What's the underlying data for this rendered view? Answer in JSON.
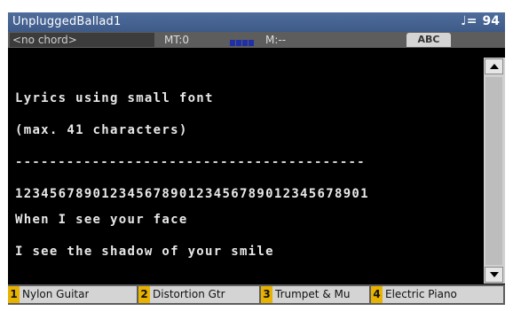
{
  "title_bar": {
    "song_name": "UnpluggedBallad1",
    "tempo_icon": "♩=",
    "tempo": "94"
  },
  "info_bar": {
    "chord": "<no chord>",
    "master_transpose": "MT:0",
    "measure": "M:--",
    "abc_label": "ABC"
  },
  "lyrics": {
    "lines": [
      "Lyrics using small font",
      "(max. 41 characters)",
      "-----------------------------------------",
      "12345678901234567890123456789012345678901",
      "When I see your face",
      "I see the shadow of your smile"
    ]
  },
  "scrollbar": {
    "up_icon": "arrow-up",
    "down_icon": "arrow-down"
  },
  "pads": [
    {
      "number": "1",
      "label": "Nylon Guitar"
    },
    {
      "number": "2",
      "label": "Distortion Gtr"
    },
    {
      "number": "3",
      "label": "Trumpet & Mu"
    },
    {
      "number": "4",
      "label": "Electric Piano"
    }
  ],
  "colors": {
    "title_bar": "#3d5a88",
    "pad_number": "#e7b200",
    "beat_indicator": "#1f2fa8"
  }
}
